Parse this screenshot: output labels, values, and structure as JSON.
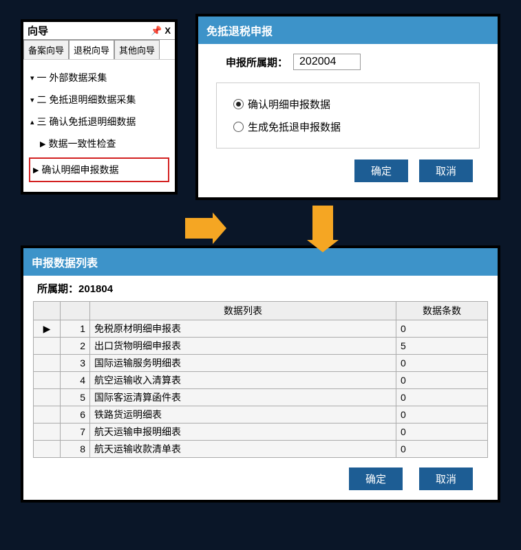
{
  "wizard": {
    "title": "向导",
    "tabs": [
      "备案向导",
      "退税向导",
      "其他向导"
    ],
    "tree": {
      "s1": "一 外部数据采集",
      "s2": "二 免抵退明细数据采集",
      "s3": "三 确认免抵退明细数据",
      "sub1": "数据一致性检查",
      "sub2": "确认明细申报数据"
    }
  },
  "dialog": {
    "title": "免抵退税申报",
    "period_label": "申报所属期：",
    "period_value": "202004",
    "radio1": "确认明细申报数据",
    "radio2": "生成免抵退申报数据",
    "ok": "确定",
    "cancel": "取消"
  },
  "bottom": {
    "title": "申报数据列表",
    "period_label": "所属期：",
    "period_value": "201804",
    "col1": "数据列表",
    "col2": "数据条数",
    "rows": [
      {
        "n": "1",
        "name": "免税原材明细申报表",
        "count": "0"
      },
      {
        "n": "2",
        "name": "出口货物明细申报表",
        "count": "5"
      },
      {
        "n": "3",
        "name": "国际运输服务明细表",
        "count": "0"
      },
      {
        "n": "4",
        "name": "航空运输收入清算表",
        "count": "0"
      },
      {
        "n": "5",
        "name": "国际客运清算函件表",
        "count": "0"
      },
      {
        "n": "6",
        "name": "铁路货运明细表",
        "count": "0"
      },
      {
        "n": "7",
        "name": "航天运输申报明细表",
        "count": "0"
      },
      {
        "n": "8",
        "name": "航天运输收款清单表",
        "count": "0"
      }
    ],
    "ok": "确定",
    "cancel": "取消"
  }
}
